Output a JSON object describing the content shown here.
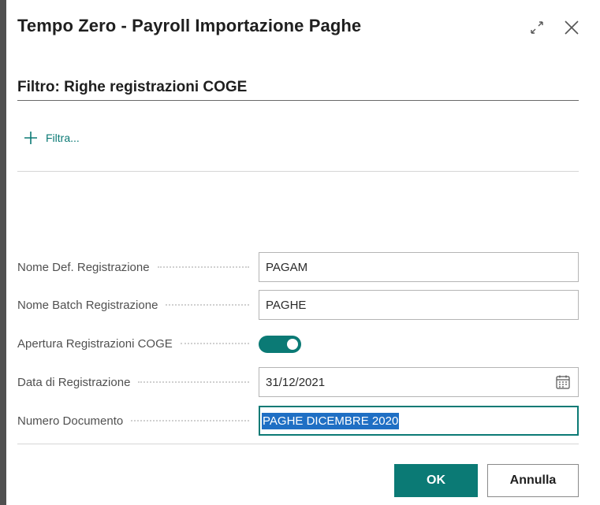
{
  "dialog": {
    "title": "Tempo Zero - Payroll Importazione Paghe",
    "icons": {
      "expand": "expand-icon",
      "close": "close-icon"
    }
  },
  "filter_section": {
    "title": "Filtro: Righe registrazioni COGE",
    "add_filter_label": "Filtra...",
    "add_filter_icon": "plus-icon"
  },
  "form": {
    "fields": [
      {
        "label": "Nome Def. Registrazione",
        "value": "PAGAM"
      },
      {
        "label": "Nome Batch Registrazione",
        "value": "PAGHE"
      },
      {
        "label": "Apertura Registrazioni COGE",
        "toggle_on": true
      },
      {
        "label": "Data di Registrazione",
        "value": "31/12/2021",
        "icon": "calendar-icon"
      },
      {
        "label": "Numero Documento",
        "value": "PAGHE DICEMBRE 2020",
        "selected": true
      }
    ]
  },
  "buttons": {
    "ok": "OK",
    "cancel": "Annulla"
  },
  "colors": {
    "accent": "#0b7a75",
    "selection": "#1f6fc4"
  }
}
